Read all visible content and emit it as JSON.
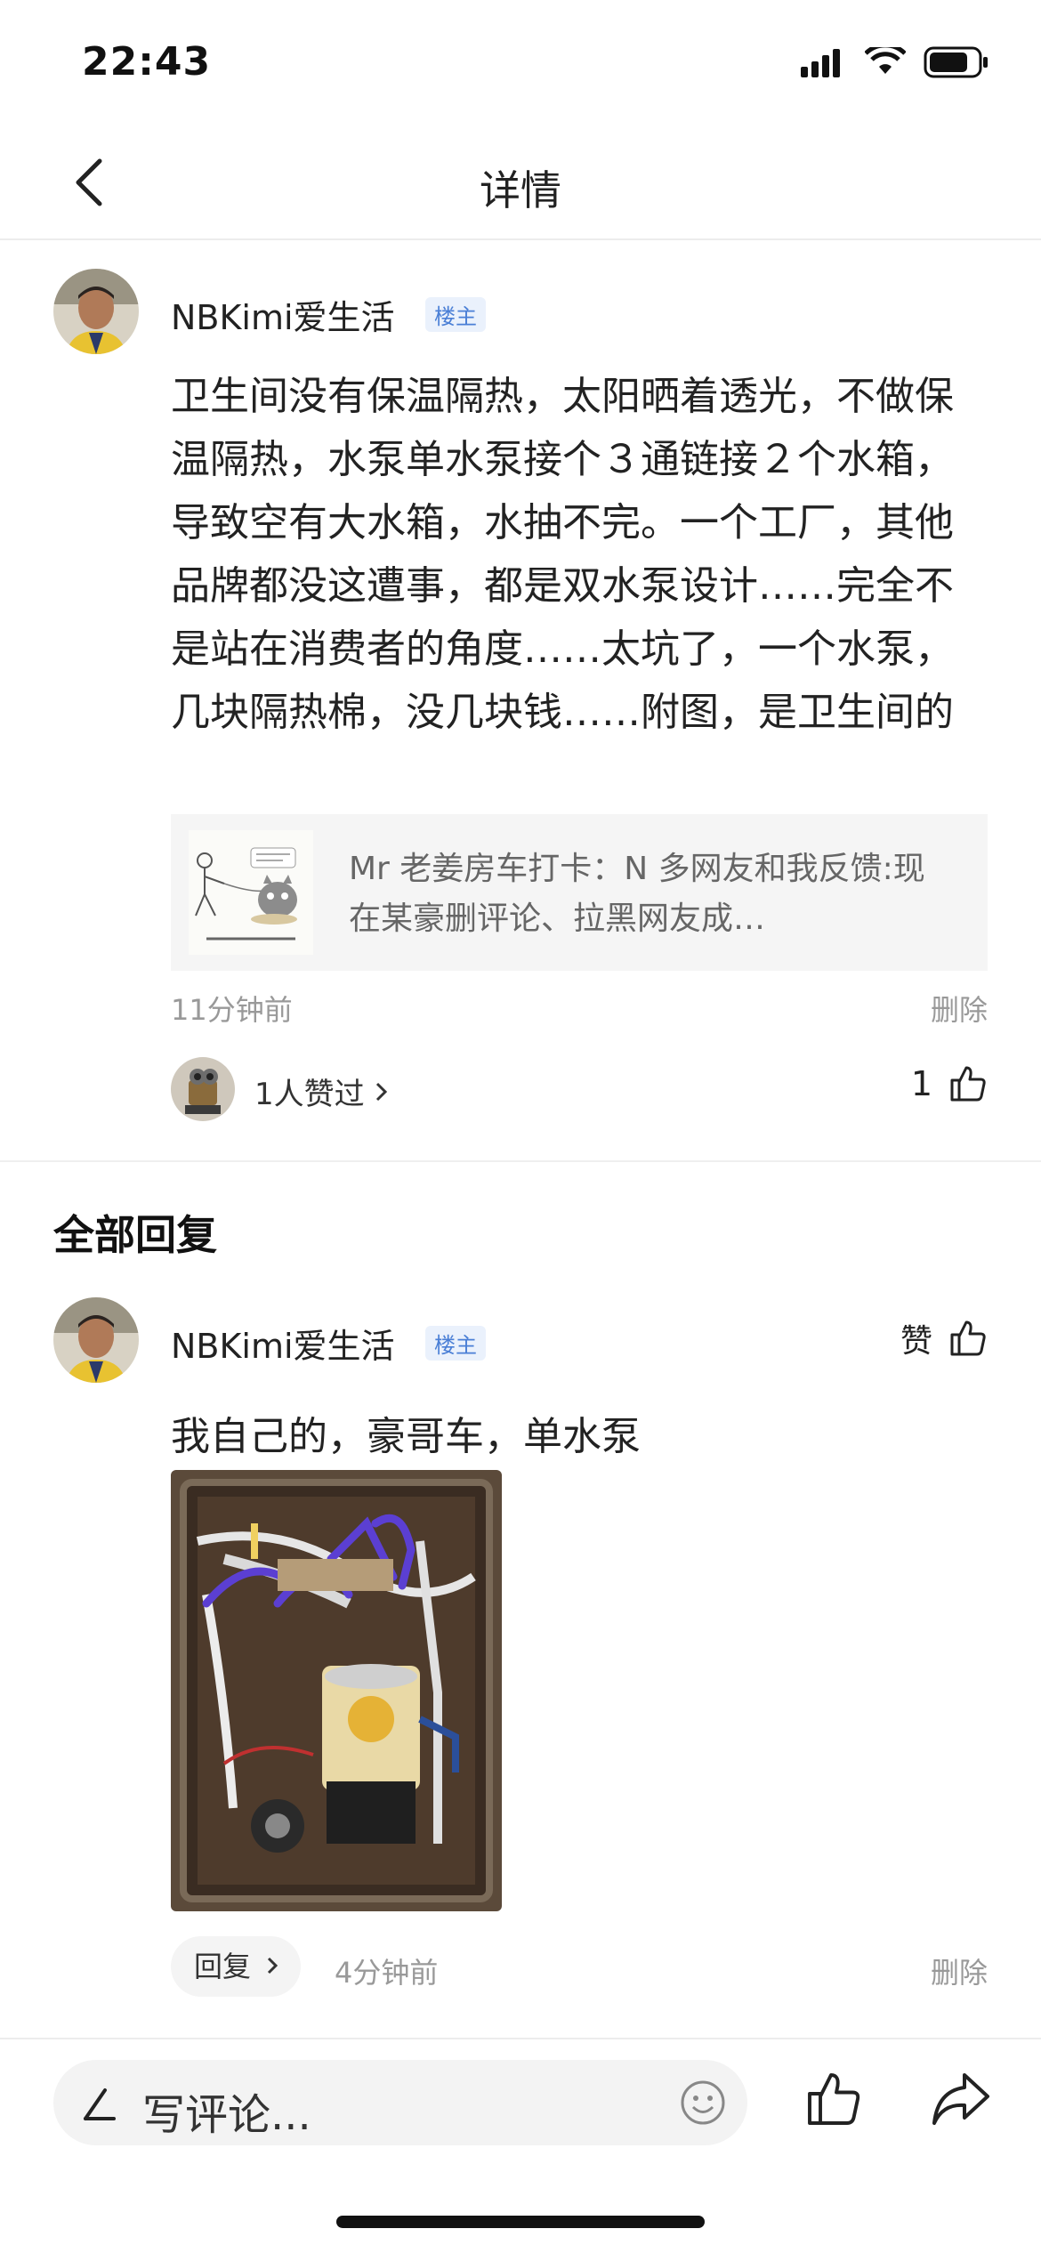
{
  "status_bar": {
    "time": "22:43"
  },
  "nav": {
    "title": "详情"
  },
  "post": {
    "author": "NBKimi爱生活",
    "badge": "楼主",
    "content": "卫生间没有保温隔热，太阳晒着透光，不做保温隔热，水泵单水泵接个３通链接２个水箱，导致空有大水箱，水抽不完。一个工厂，其他品牌都没这遭事，都是双水泵设计……完全不是站在消费者的角度……太坑了，一个水泵，几块隔热棉，没几块钱……附图，是卫生间的",
    "shared_card_text": "Mr 老姜房车打卡：N 多网友和我反馈:现在某豪删评论、拉黑网友成…",
    "time": "11分钟前",
    "delete_label": "删除",
    "likes_text": "1人赞过",
    "like_count": "1"
  },
  "replies_section": {
    "title": "全部回复"
  },
  "reply": {
    "author": "NBKimi爱生活",
    "badge": "楼主",
    "like_label": "赞",
    "content": "我自己的，豪哥车，单水泵",
    "reply_button": "回复",
    "time": "4分钟前",
    "delete_label": "删除"
  },
  "bottom_bar": {
    "comment_placeholder": "写评论..."
  },
  "colors": {
    "badge_blue": "#4a7fd6",
    "meta_gray": "#999999"
  }
}
